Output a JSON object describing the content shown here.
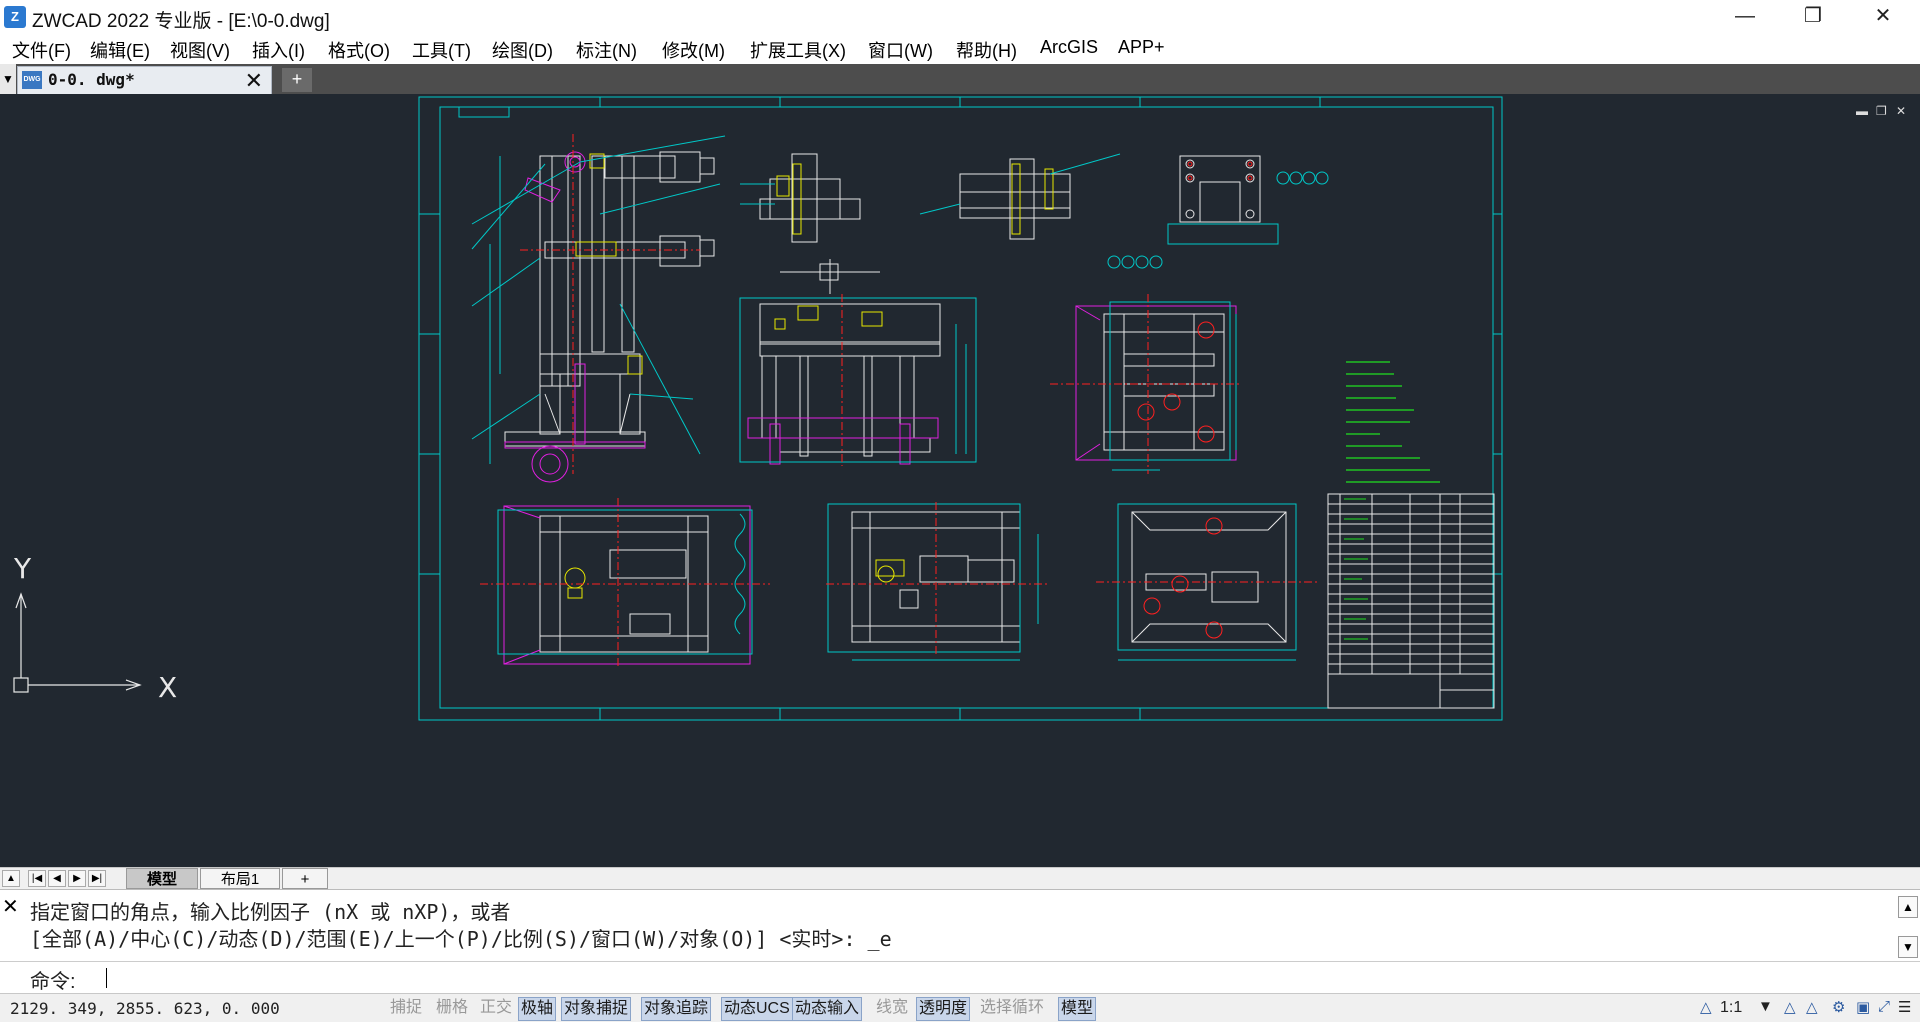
{
  "window": {
    "title": "ZWCAD 2022 专业版 - [E:\\0-0.dwg]",
    "app_icon": "zwcad-logo",
    "minimize_glyph": "—",
    "restore_glyph": "❐",
    "close_glyph": "✕"
  },
  "menu": [
    "文件(F)",
    "编辑(E)",
    "视图(V)",
    "插入(I)",
    "格式(O)",
    "工具(T)",
    "绘图(D)",
    "标注(N)",
    "修改(M)",
    "扩展工具(X)",
    "窗口(W)",
    "帮助(H)",
    "ArcGIS",
    "APP+"
  ],
  "tabs": {
    "dropdown_glyph": "▼",
    "doc_label": "0-0. dwg*",
    "doc_icon_text": "DWG",
    "close_glyph": "✕",
    "new_glyph": "+"
  },
  "viewport": {
    "minimize_glyph": "▬",
    "restore_glyph": "❐",
    "close_glyph": "✕",
    "ucs_x_label": "X",
    "ucs_y_label": "Y"
  },
  "layouts": {
    "nav_glyphs": [
      "▲",
      "|◀",
      "◀",
      "▶",
      "▶|"
    ],
    "model_tab": "模型",
    "layout1_tab": "布局1",
    "add_glyph": "+"
  },
  "command": {
    "close_glyph": "✕",
    "history_line1": "指定窗口的角点，输入比例因子 (nX 或 nXP)，或者",
    "history_line2": "[全部(A)/中心(C)/动态(D)/范围(E)/上一个(P)/比例(S)/窗口(W)/对象(O)] <实时>: _e",
    "prompt": "命令:",
    "scroll_up": "▲",
    "scroll_down": "▼"
  },
  "status": {
    "coordinates": "2129. 349,  2855. 623,  0. 000",
    "toggles": [
      {
        "label": "捕捉",
        "on": false
      },
      {
        "label": "栅格",
        "on": false
      },
      {
        "label": "正交",
        "on": false
      },
      {
        "label": "极轴",
        "on": true
      },
      {
        "label": "对象捕捉",
        "on": true
      },
      {
        "label": "对象追踪",
        "on": true
      },
      {
        "label": "动态UCS",
        "on": true
      },
      {
        "label": "动态输入",
        "on": true
      },
      {
        "label": "线宽",
        "on": false
      },
      {
        "label": "透明度",
        "on": true
      },
      {
        "label": "选择循环",
        "on": false
      },
      {
        "label": "模型",
        "on": true
      }
    ],
    "annotation_scale": "1:1"
  },
  "colors": {
    "canvas_bg": "#212830",
    "frame": "#00c8c8",
    "drawing_white": "#e8e8e8",
    "magenta": "#e020e0",
    "yellow": "#e8e800",
    "red": "#ff2020",
    "green": "#20e020"
  }
}
